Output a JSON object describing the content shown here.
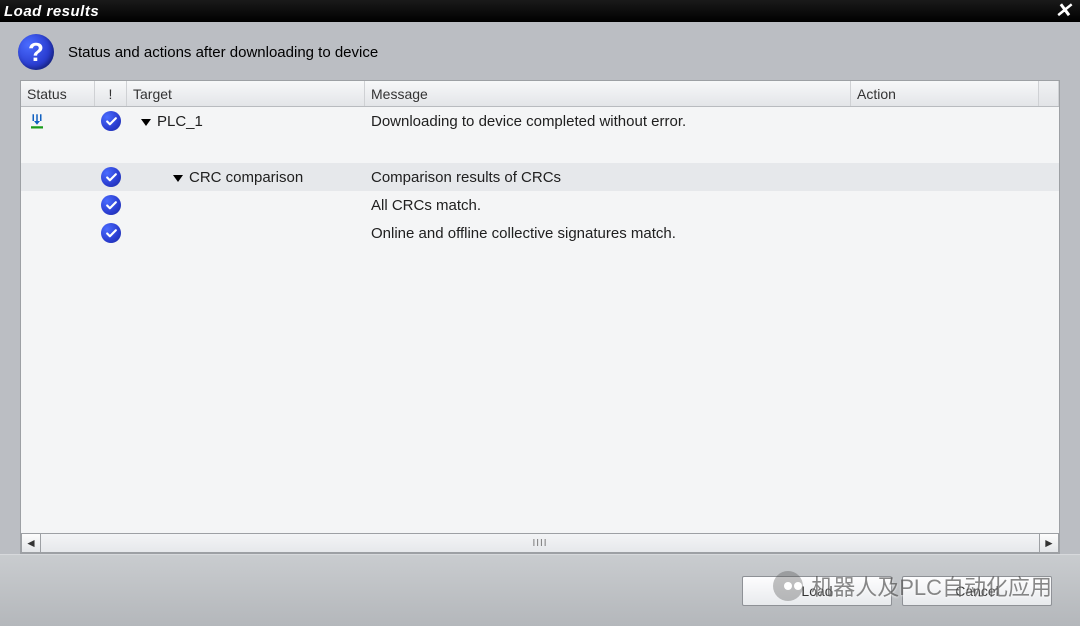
{
  "title": "Load results",
  "header_text": "Status and actions after downloading to device",
  "columns": {
    "status": "Status",
    "bang": "!",
    "target": "Target",
    "message": "Message",
    "action": "Action"
  },
  "rows": [
    {
      "status_icon": "download-arrow",
      "check": true,
      "indent": 1,
      "expand": true,
      "target": "PLC_1",
      "message": "Downloading to device completed without error.",
      "shade": false
    },
    {
      "status_icon": "",
      "check": true,
      "indent": 2,
      "expand": true,
      "target": "CRC comparison",
      "message": "Comparison results of CRCs",
      "shade": true
    },
    {
      "status_icon": "",
      "check": true,
      "indent": 2,
      "expand": false,
      "target": "",
      "message": "All CRCs match.",
      "shade": false
    },
    {
      "status_icon": "",
      "check": true,
      "indent": 2,
      "expand": false,
      "target": "",
      "message": "Online and offline collective signatures match.",
      "shade": false
    }
  ],
  "buttons": {
    "load": "Load",
    "cancel": "Cancel"
  },
  "watermark": "机器人及PLC自动化应用"
}
